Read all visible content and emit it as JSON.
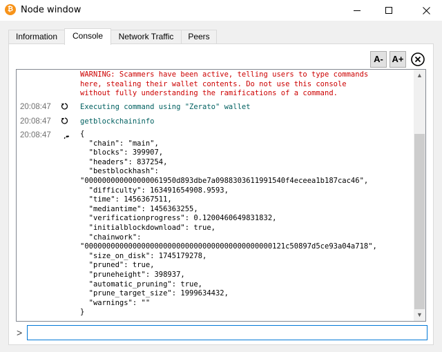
{
  "window": {
    "title": "Node window",
    "app_icon": "bitcoin-icon",
    "app_icon_glyph": "₿"
  },
  "tabs": [
    {
      "label": "Information",
      "active": false
    },
    {
      "label": "Console",
      "active": true
    },
    {
      "label": "Network Traffic",
      "active": false
    },
    {
      "label": "Peers",
      "active": false
    }
  ],
  "toolbar": {
    "font_decrease": "A-",
    "font_increase": "A+",
    "clear": "clear-console-icon"
  },
  "console": {
    "warning": "WARNING: Scammers have been active, telling users to type commands\nhere, stealing their wallet contents. Do not use this console\nwithout fully understanding the ramifications of a command.",
    "entries": [
      {
        "time": "20:08:47",
        "text": "Executing command using \"Zerato\" wallet",
        "kind": "info"
      },
      {
        "time": "20:08:47",
        "text": "getblockchaininfo",
        "kind": "command"
      },
      {
        "time": "20:08:47",
        "text": "",
        "kind": "reply"
      }
    ],
    "reply": "{\n  \"chain\": \"main\",\n  \"blocks\": 399907,\n  \"headers\": 837254,\n  \"bestblockhash\":\n\"000000000000000061950d893dbe7a0988303611991540f4eceea1b187cac46\",\n  \"difficulty\": 163491654908.9593,\n  \"time\": 1456367511,\n  \"mediantime\": 1456363255,\n  \"verificationprogress\": 0.1200460649831832,\n  \"initialblockdownload\": true,\n  \"chainwork\":\n\"0000000000000000000000000000000000000000000121c50897d5ce93a04a718\",\n  \"size_on_disk\": 1745179278,\n  \"pruned\": true,\n  \"pruneheight\": 398937,\n  \"automatic_pruning\": true,\n  \"prune_target_size\": 1999634432,\n  \"warnings\": \"\"\n}"
  },
  "input": {
    "value": "",
    "prompt": ">"
  },
  "colors": {
    "warning": "#cc0000",
    "info": "#006060",
    "accent": "#0078d7"
  }
}
